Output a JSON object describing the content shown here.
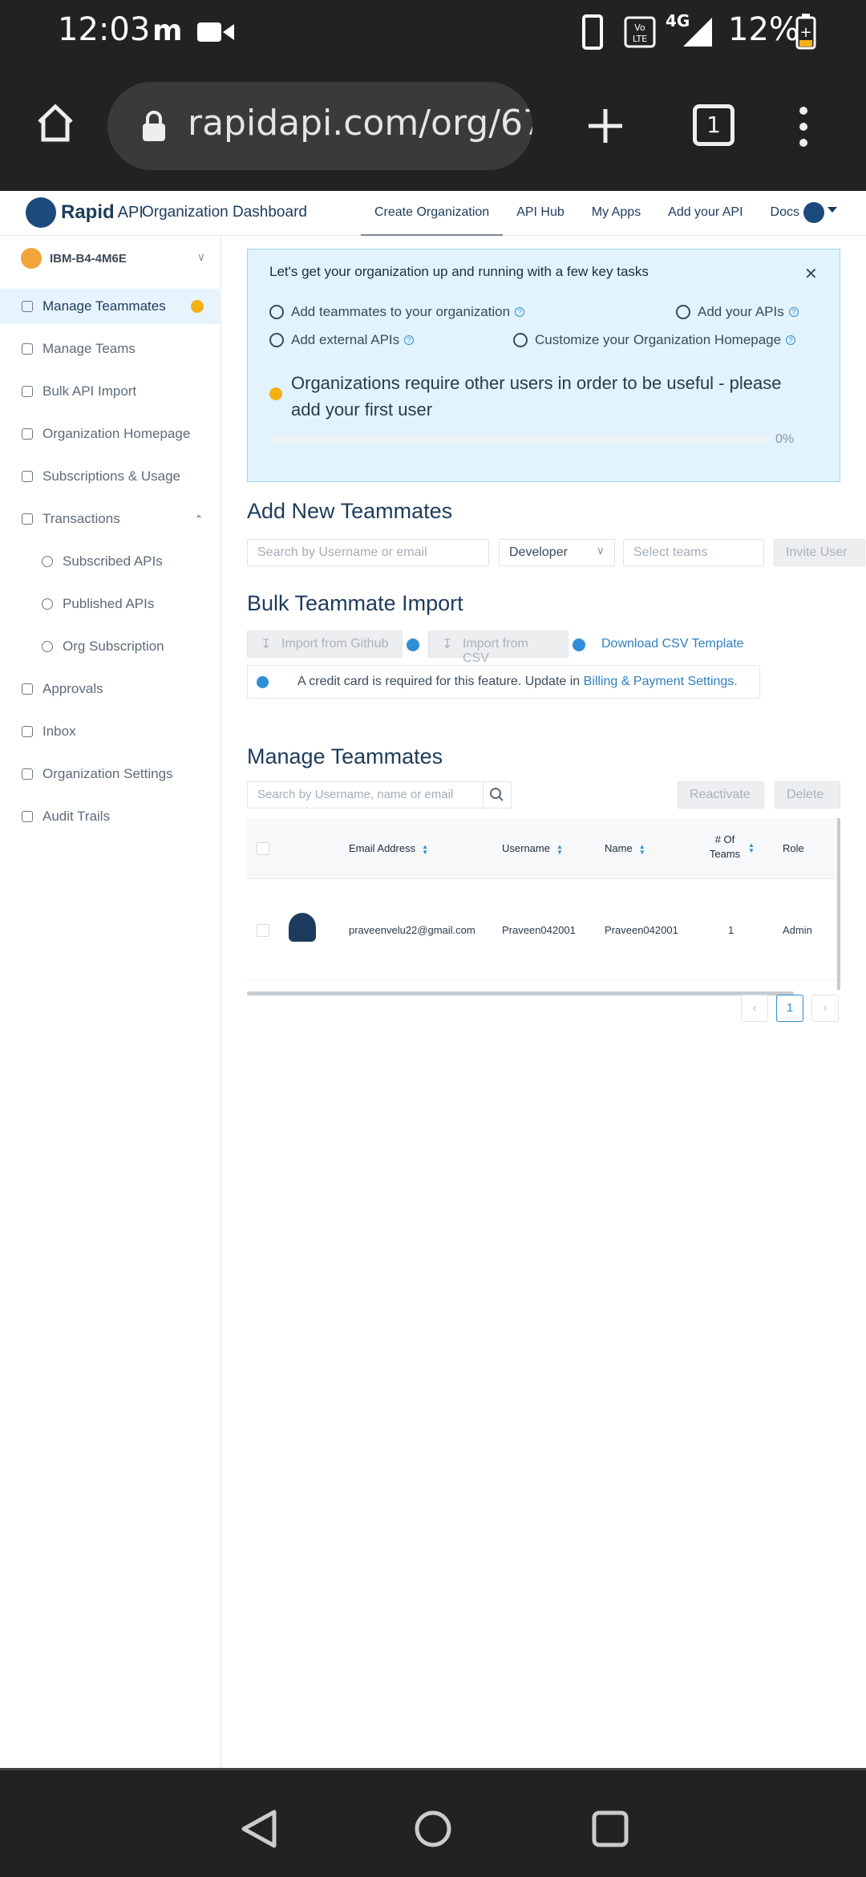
{
  "status": {
    "time": "12:03",
    "battery": "12%",
    "network": "4G"
  },
  "browser": {
    "url": "rapidapi.com/org/67",
    "tab_count": "1"
  },
  "nav": {
    "brand": "Rapid",
    "brand_suffix": "API",
    "title": "Organization Dashboard",
    "links": [
      "Create Organization",
      "API Hub",
      "My Apps",
      "Add your API",
      "Docs"
    ]
  },
  "sidebar": {
    "org_name": "IBM-B4-4M6E",
    "items": [
      {
        "label": "Manage Teammates",
        "icon": "user-icon"
      },
      {
        "label": "Manage Teams",
        "icon": "users-icon"
      },
      {
        "label": "Bulk API Import",
        "icon": "upload-icon"
      },
      {
        "label": "Organization Homepage",
        "icon": "home-icon"
      },
      {
        "label": "Subscriptions & Usage",
        "icon": "link-icon"
      },
      {
        "label": "Transactions",
        "icon": "cart-icon"
      },
      {
        "label": "Subscribed APIs",
        "icon": "dollar-icon"
      },
      {
        "label": "Published APIs",
        "icon": "dollar-icon"
      },
      {
        "label": "Org Subscription",
        "icon": "check-circle-icon"
      },
      {
        "label": "Approvals",
        "icon": "thumbs-up-icon"
      },
      {
        "label": "Inbox",
        "icon": "mail-icon"
      },
      {
        "label": "Organization Settings",
        "icon": "gear-icon"
      },
      {
        "label": "Audit Trails",
        "icon": "search-icon"
      }
    ]
  },
  "tasks": {
    "title": "Let's get your organization up and running with a few key tasks",
    "items": [
      "Add teammates to your organization",
      "Add your APIs",
      "Add external APIs",
      "Customize your Organization Homepage"
    ],
    "warning": "Organizations require other users in order to be useful - please add your first user",
    "progress_fraction": 0,
    "progress_label": "0%"
  },
  "add_teammates": {
    "heading": "Add New Teammates",
    "search_placeholder": "Search by Username or email",
    "role": "Developer",
    "teams_placeholder": "Select teams",
    "invite": "Invite User"
  },
  "bulk": {
    "heading": "Bulk Teammate Import",
    "github": "Import from Github",
    "csv": "Import from CSV",
    "template": "Download CSV Template",
    "notice": "A credit card is required for this feature. Update in",
    "notice_link": "Billing & Payment Settings."
  },
  "manage": {
    "heading": "Manage Teammates",
    "search_placeholder": "Search by Username, name or email",
    "reactivate": "Reactivate",
    "delete": "Delete",
    "columns": [
      "Email Address",
      "Username",
      "Name",
      "# Of Teams",
      "Role"
    ],
    "rows": [
      {
        "email": "praveenvelu22@gmail.com",
        "username": "Praveen042001",
        "name": "Praveen042001",
        "teams": "1",
        "role": "Admin"
      }
    ],
    "page": "1"
  }
}
